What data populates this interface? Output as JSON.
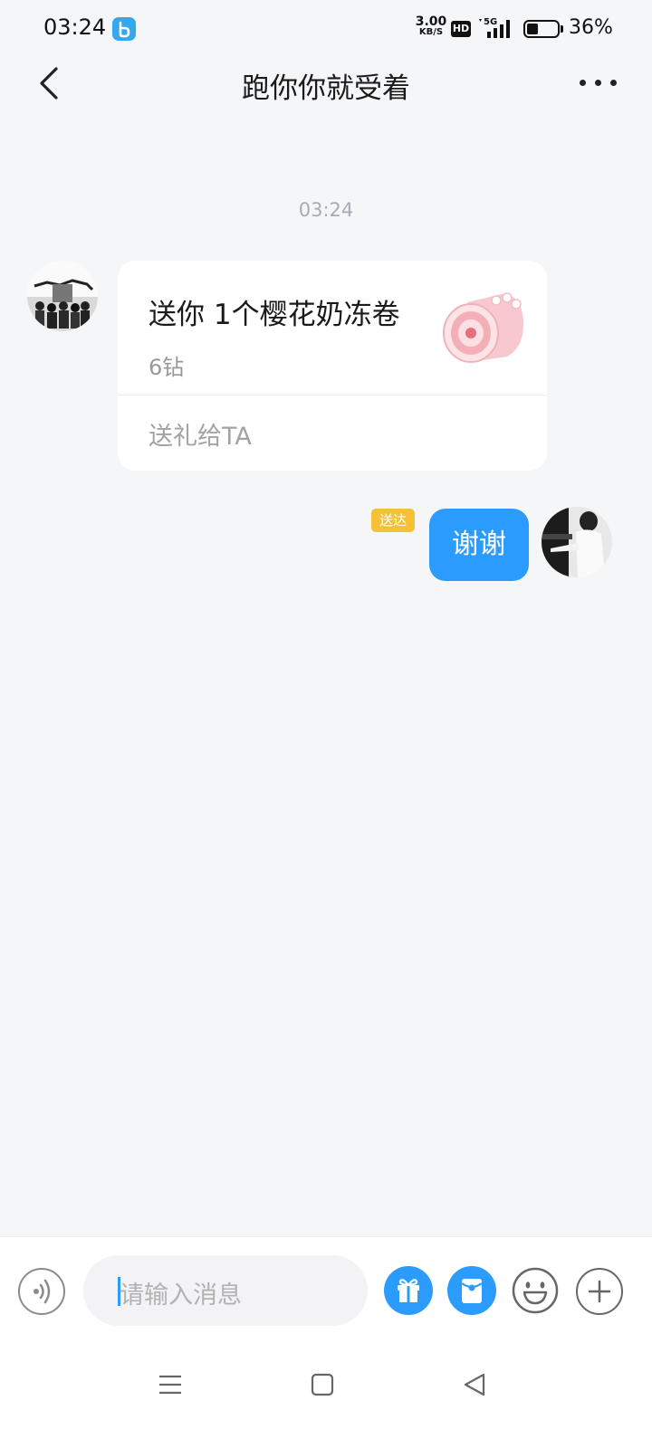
{
  "status_bar": {
    "time": "03:24",
    "net_speed_value": "3.00",
    "net_speed_unit": "KB/S",
    "hd_label": "HD",
    "network_label": "5G",
    "battery_percent_text": "36%",
    "battery_level": 0.36,
    "app_icon": "app-notification-icon"
  },
  "header": {
    "title": "跑你你就受着",
    "back_icon": "chevron-left-icon",
    "more_icon": "more-dots-icon"
  },
  "chat": {
    "timestamp": "03:24",
    "gift_message": {
      "title": "送你 1个樱花奶冻卷",
      "price": "6钻",
      "action": "送礼给TA",
      "gift_icon": "cherry-blossom-roll-icon"
    },
    "sent_message": {
      "text": "谢谢",
      "status": "送达"
    }
  },
  "input_bar": {
    "placeholder": "请输入消息",
    "icons": [
      "voice-icon",
      "gift-icon",
      "red-packet-icon",
      "emoji-icon",
      "plus-icon"
    ]
  },
  "nav_bar": {
    "icons": [
      "menu-icon",
      "home-icon",
      "back-triangle-icon"
    ]
  },
  "colors": {
    "accent": "#2b9bfd",
    "badge": "#f7c137",
    "background": "#f5f6f8"
  }
}
